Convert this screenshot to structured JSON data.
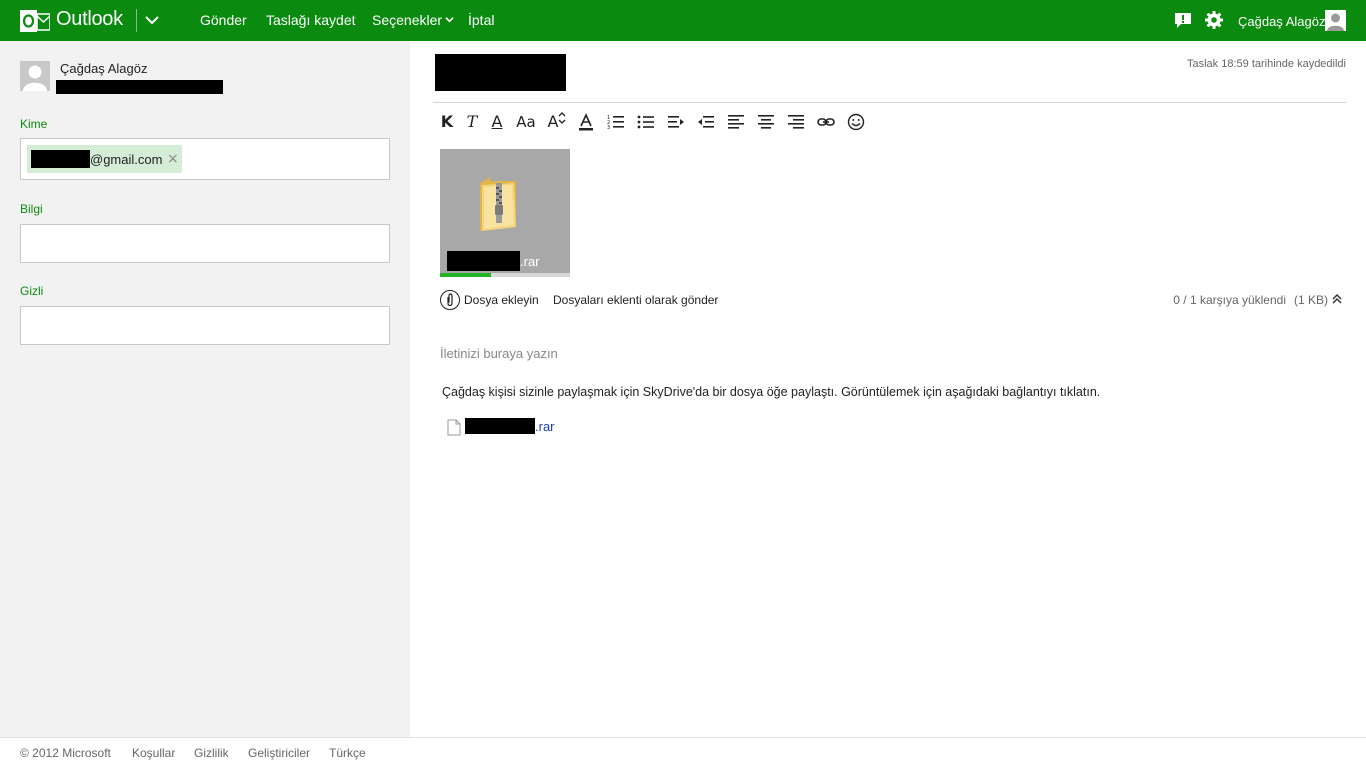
{
  "header": {
    "brand": "Outlook",
    "nav": {
      "send": "Gönder",
      "save_draft": "Taslağı kaydet",
      "options": "Seçenekler",
      "cancel": "İptal"
    },
    "user_name": "Çağdaş Alagöz",
    "brand_color": "#0b8a10"
  },
  "sender": {
    "name": "Çağdaş Alagöz"
  },
  "fields": {
    "to_label": "Kime",
    "to_recipient_suffix": "@gmail.com",
    "cc_label": "Bilgi",
    "bcc_label": "Gizli"
  },
  "draft": {
    "saved_note": "Taslak 18:59 tarihinde kaydedildi"
  },
  "toolbar": {
    "bold": "K",
    "italic": "T",
    "underline": "A",
    "font_size": "Aa",
    "grow": "A"
  },
  "attachment": {
    "extension": ".rar",
    "upload_progress": 0.39
  },
  "attach_bar": {
    "add_file": "Dosya ekleyin",
    "send_as_attachment": "Dosyaları eklenti olarak gönder",
    "status": "0 / 1 karşıya yüklendi",
    "size": "(1 KB)"
  },
  "body": {
    "placeholder": "İletinizi buraya yazın",
    "share_text": "Çağdaş kişisi sizinle paylaşmak için SkyDrive'da bir dosya öğe paylaştı. Görüntülemek için aşağıdaki bağlantıyı tıklatın.",
    "file_extension": ".rar"
  },
  "footer": {
    "copyright": "© 2012 Microsoft",
    "terms": "Koşullar",
    "privacy": "Gizlilik",
    "developers": "Geliştiriciler",
    "language": "Türkçe"
  }
}
